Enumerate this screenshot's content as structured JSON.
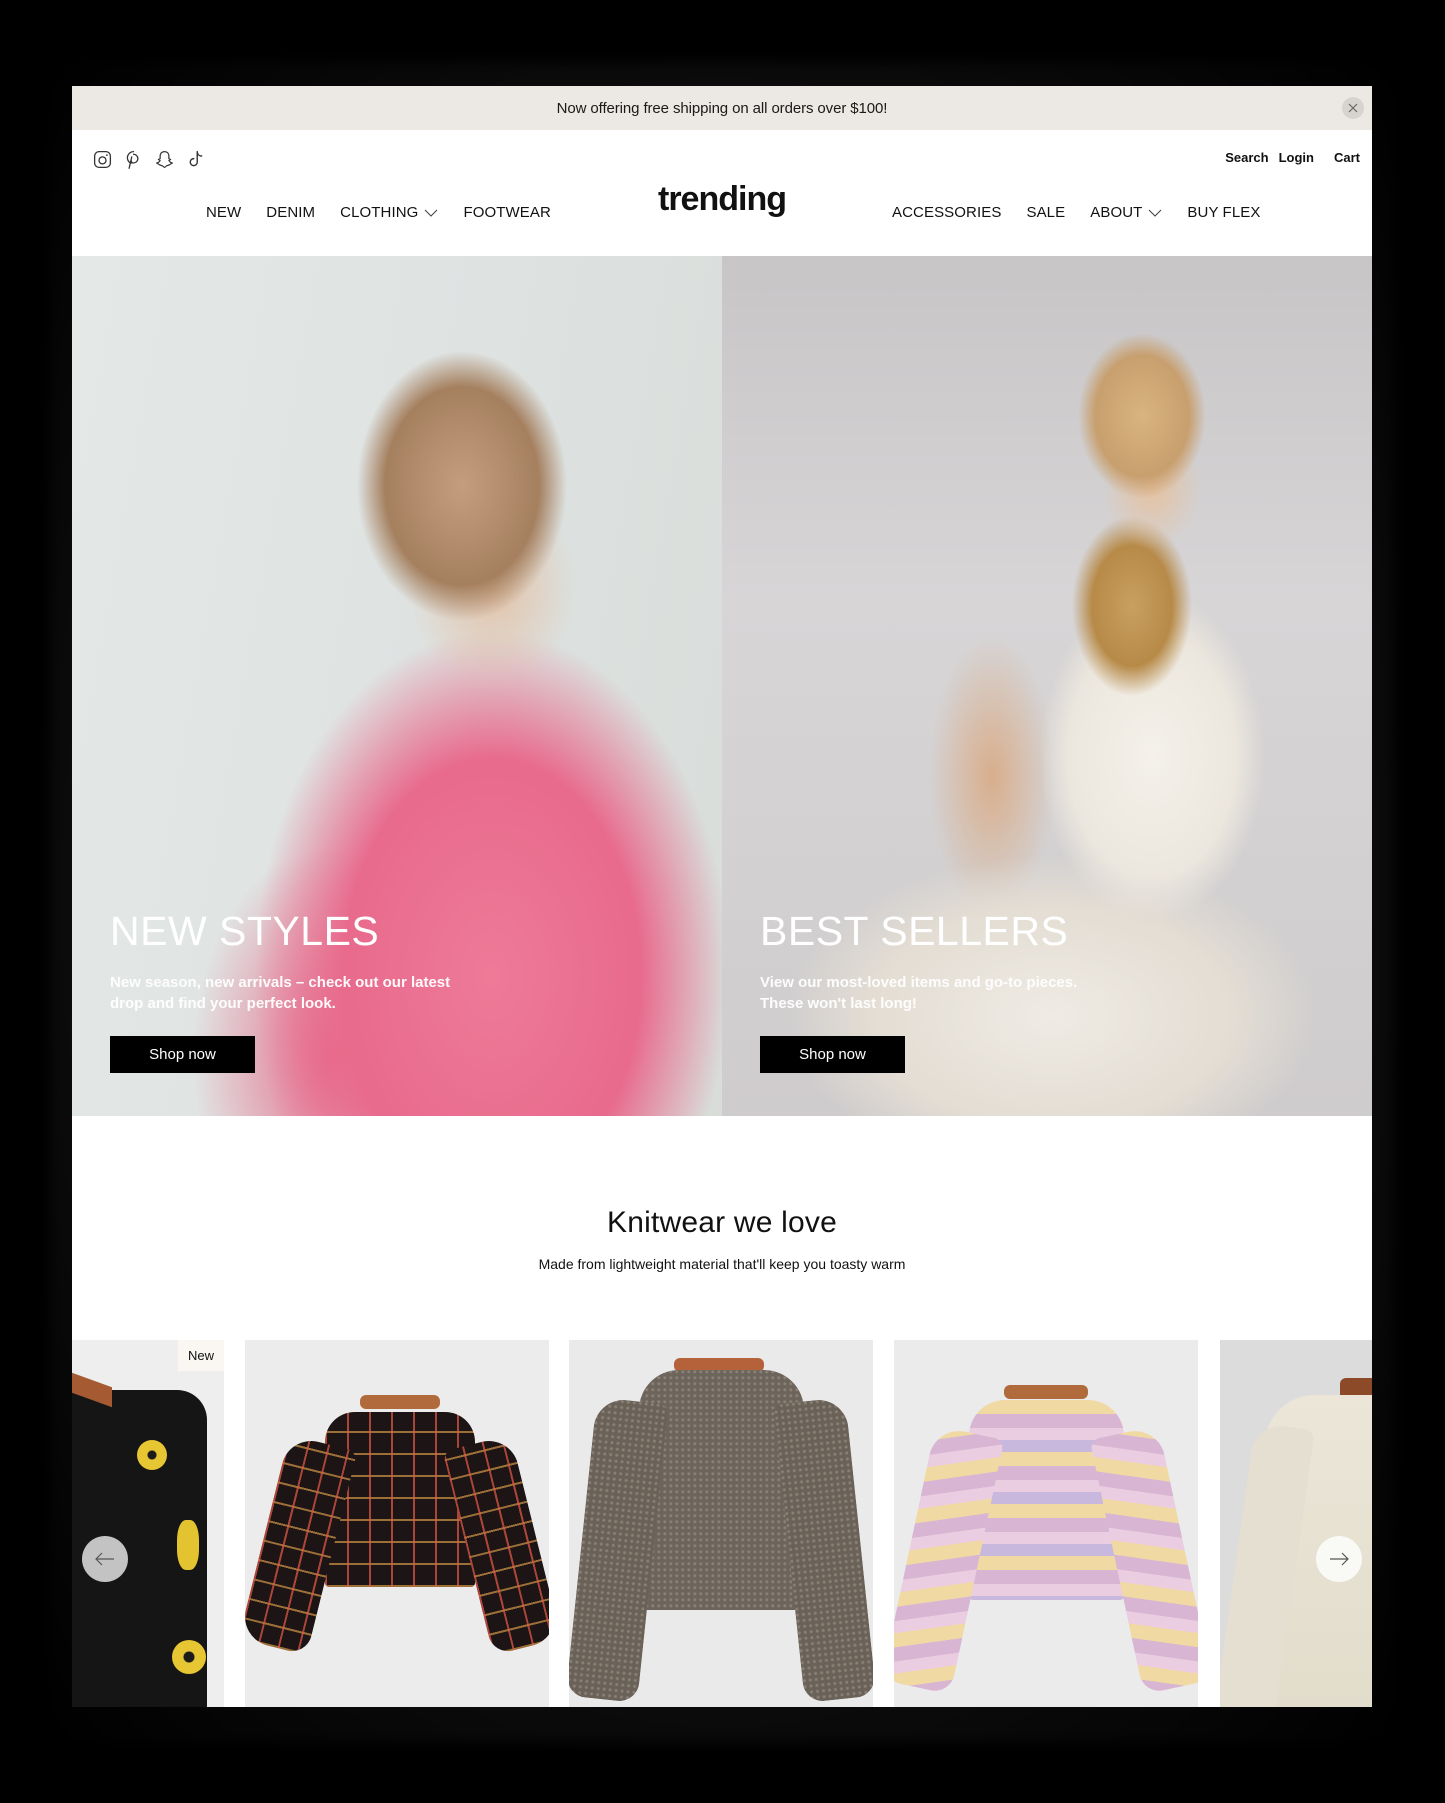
{
  "announcement": {
    "text": "Now offering free shipping on all orders over $100!",
    "close_icon": "close-icon"
  },
  "header": {
    "logo": "trending",
    "socials": [
      {
        "name": "instagram",
        "icon": "instagram-icon"
      },
      {
        "name": "pinterest",
        "icon": "pinterest-icon"
      },
      {
        "name": "snapchat",
        "icon": "snapchat-icon"
      },
      {
        "name": "tiktok",
        "icon": "tiktok-icon"
      }
    ],
    "utility": {
      "search": "Search",
      "login": "Login",
      "cart": "Cart"
    },
    "nav_left": [
      {
        "label": "NEW",
        "dropdown": false
      },
      {
        "label": "DENIM",
        "dropdown": false
      },
      {
        "label": "CLOTHING",
        "dropdown": true
      },
      {
        "label": "FOOTWEAR",
        "dropdown": false
      }
    ],
    "nav_right": [
      {
        "label": "ACCESSORIES",
        "dropdown": false
      },
      {
        "label": "SALE",
        "dropdown": false
      },
      {
        "label": "ABOUT",
        "dropdown": true
      },
      {
        "label": "BUY FLEX",
        "dropdown": false
      }
    ]
  },
  "hero": [
    {
      "title": "NEW STYLES",
      "text": "New season, new arrivals – check out our latest drop and find your perfect look.",
      "button": "Shop now"
    },
    {
      "title": "BEST SELLERS",
      "text": "View our most-loved items and go-to pieces. These won't last long!",
      "button": "Shop now"
    }
  ],
  "knitwear": {
    "title": "Knitwear we love",
    "subtitle": "Made from lightweight material that'll keep you toasty warm",
    "products": [
      {
        "description": "Black cardigan with yellow flowers",
        "badge": "New"
      },
      {
        "description": "Black multicolor plaid cropped sweater",
        "badge": ""
      },
      {
        "description": "Grey marled cropped sweater",
        "badge": ""
      },
      {
        "description": "Pastel striped cropped sweater",
        "badge": ""
      },
      {
        "description": "Cream knit sweater",
        "badge": ""
      }
    ],
    "prev_icon": "arrow-left-icon",
    "next_icon": "arrow-right-icon"
  },
  "colors": {
    "announcement_bg": "#ece8e3",
    "button_bg": "#000000",
    "text": "#111111"
  }
}
